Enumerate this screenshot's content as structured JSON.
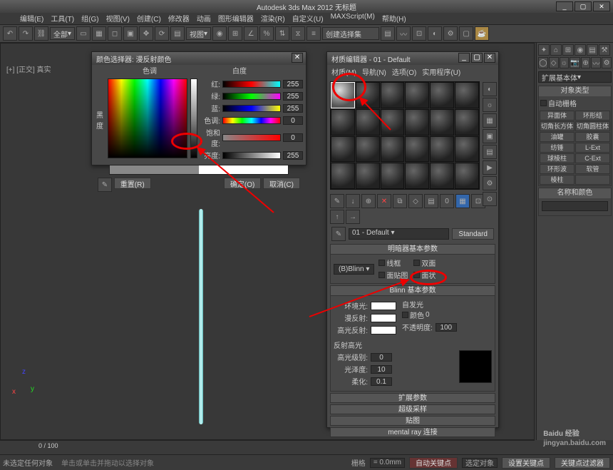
{
  "title": "Autodesk 3ds Max 2012      无标题",
  "window_buttons": [
    "_",
    "▢",
    "✕"
  ],
  "menu": [
    "编辑(E)",
    "工具(T)",
    "组(G)",
    "视图(V)",
    "创建(C)",
    "修改器",
    "动画",
    "图形编辑器",
    "渲染(R)",
    "自定义(U)",
    "MAXScript(M)",
    "帮助(H)"
  ],
  "toolbar_drop": "全部",
  "toolbar_drop2": "视图",
  "toolbar_drop3": "创建选择集",
  "viewport_label": "[+] [正交] 真实",
  "axis": {
    "x": "x",
    "y": "y",
    "z": "z"
  },
  "color_picker": {
    "title": "颜色选择器: 漫反射颜色",
    "hue_label": "色调",
    "white_label": "白度",
    "black_label": "黑\n度",
    "rows": [
      {
        "lab": "红:",
        "bar": "linear-gradient(to right,#000,#f00,#0ff)",
        "val": "255"
      },
      {
        "lab": "绿:",
        "bar": "linear-gradient(to right,#000,#0f0,#f0f)",
        "val": "255"
      },
      {
        "lab": "蓝:",
        "bar": "linear-gradient(to right,#000,#00f,#ff0)",
        "val": "255"
      },
      {
        "lab": "色调:",
        "bar": "linear-gradient(to right,red,yellow,lime,cyan,blue,magenta,red)",
        "val": "0"
      },
      {
        "lab": "饱和度:",
        "bar": "linear-gradient(to right,#888,#f00)",
        "val": "0"
      },
      {
        "lab": "亮度:",
        "bar": "linear-gradient(to right,#000,#fff)",
        "val": "255"
      }
    ],
    "swatch_old": "#888",
    "swatch_new": "#fff",
    "reset": "重置(R)",
    "ok": "确定(O)",
    "cancel": "取消(C)"
  },
  "material_editor": {
    "title": "材质编辑器 - 01 - Default",
    "menu": [
      "材质(M)",
      "导航(N)",
      "选项(O)",
      "实用程序(U)"
    ],
    "slot_count": 24,
    "selected_slot": 0,
    "name": "01 - Default",
    "type_btn": "Standard",
    "sections": {
      "shader_basic": "明暗器基本参数",
      "shader": "(B)Blinn",
      "shader_opts": [
        "线框",
        "双面",
        "面贴图",
        "面状"
      ],
      "blinn_basic": "Blinn 基本参数",
      "ambient": "环境光:",
      "diffuse": "漫反射:",
      "specular": "高光反射:",
      "self_illum": "自发光",
      "self_color": "颜色",
      "self_val": "0",
      "opacity": "不透明度:",
      "opacity_val": "100",
      "spec_hl": "反射高光",
      "spec_level": "高光级别:",
      "spec_level_val": "0",
      "gloss": "光泽度:",
      "gloss_val": "10",
      "soften": "柔化:",
      "soften_val": "0.1",
      "rollouts": [
        "扩展参数",
        "超级采样",
        "贴图",
        "mental ray 连接"
      ]
    }
  },
  "cmd_panel": {
    "dropdown": "扩展基本体",
    "sec1": "对象类型",
    "autogrid": "自动栅格",
    "prims": [
      "异面体",
      "环形结",
      "切角长方体",
      "切角圆柱体",
      "油罐",
      "胶囊",
      "纺锤",
      "L-Ext",
      "球棱柱",
      "C-Ext",
      "环形波",
      "软管",
      "棱柱",
      ""
    ],
    "sec2": "名称和颜色"
  },
  "timeline_pos": "0 / 100",
  "status": {
    "sel": "未选定任何对象",
    "hint": "单击或单击并拖动以选择对象",
    "grid_lab": "栅格",
    "grid_val": "= 0.0mm",
    "autokey": "自动关键点",
    "selkey": "选定对象",
    "setkey": "设置关键点",
    "keyfilter": "关键点过滤器"
  },
  "watermark": {
    "brand": "Baidu 经验",
    "url": "jingyan.baidu.com"
  }
}
